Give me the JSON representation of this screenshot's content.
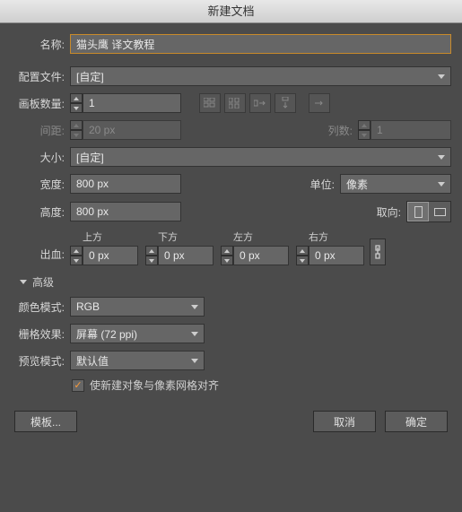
{
  "title": "新建文档",
  "labels": {
    "name": "名称:",
    "profile": "配置文件:",
    "artboard_count": "画板数量:",
    "spacing": "间距:",
    "columns": "列数:",
    "size": "大小:",
    "width": "宽度:",
    "height": "高度:",
    "units": "单位:",
    "orientation": "取向:",
    "bleed": "出血:",
    "top": "上方",
    "bottom": "下方",
    "left": "左方",
    "right": "右方",
    "advanced": "高级",
    "color_mode": "颜色模式:",
    "raster_effect": "栅格效果:",
    "preview_mode": "预览模式:"
  },
  "values": {
    "name": "猫头鹰 译文教程",
    "profile": "[自定]",
    "artboard_count": "1",
    "spacing": "20 px",
    "columns": "1",
    "size": "[自定]",
    "width": "800 px",
    "height": "800 px",
    "units": "像素",
    "bleed_top": "0 px",
    "bleed_bottom": "0 px",
    "bleed_left": "0 px",
    "bleed_right": "0 px",
    "color_mode": "RGB",
    "raster_effect": "屏幕 (72 ppi)",
    "preview_mode": "默认值"
  },
  "checkbox": {
    "align_pixel_grid": "使新建对象与像素网格对齐"
  },
  "buttons": {
    "template": "模板...",
    "cancel": "取消",
    "ok": "确定"
  }
}
